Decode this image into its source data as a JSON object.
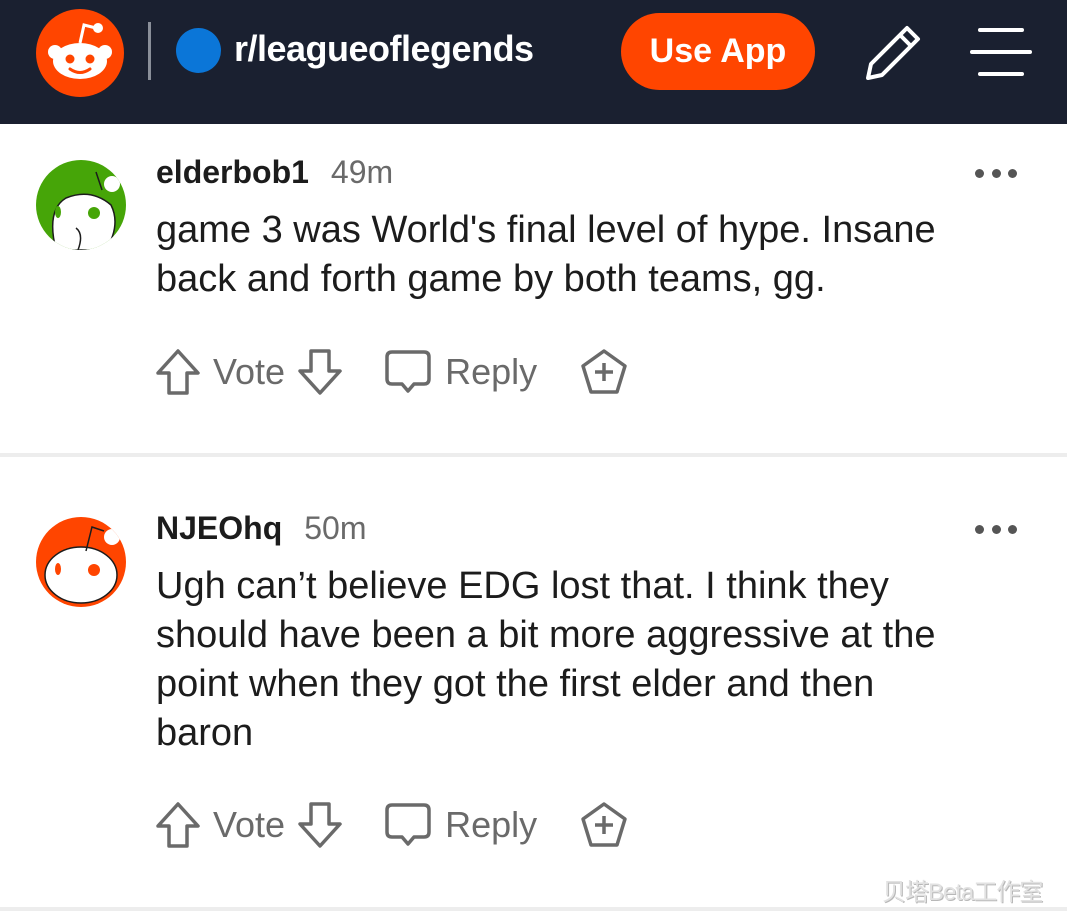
{
  "header": {
    "logo": "reddit-snoo-logo",
    "subreddit": "r/leagueoflegends",
    "use_app_label": "Use App",
    "icons": [
      "pencil-icon",
      "hamburger-menu-icon"
    ],
    "colors": {
      "bar": "#1a2030",
      "accent": "#ff4500",
      "sub_dot": "#0b76d8"
    }
  },
  "comments": [
    {
      "username": "elderbob1",
      "time": "49m",
      "body_lines": [
        "game 3 was World's final level of hype. Insane",
        "back and forth game by both teams, gg."
      ],
      "avatar_color": "#46a508",
      "vote_label": "Vote",
      "reply_label": "Reply"
    },
    {
      "username": "NJEOhq",
      "time": "50m",
      "body_lines": [
        "Ugh can’t believe EDG lost that. I think they",
        "should have been a bit more aggressive at the",
        "point when they got the first elder and then",
        "baron"
      ],
      "avatar_color": "#ff4500",
      "vote_label": "Vote",
      "reply_label": "Reply"
    }
  ],
  "watermark": "贝塔Beta工作室"
}
